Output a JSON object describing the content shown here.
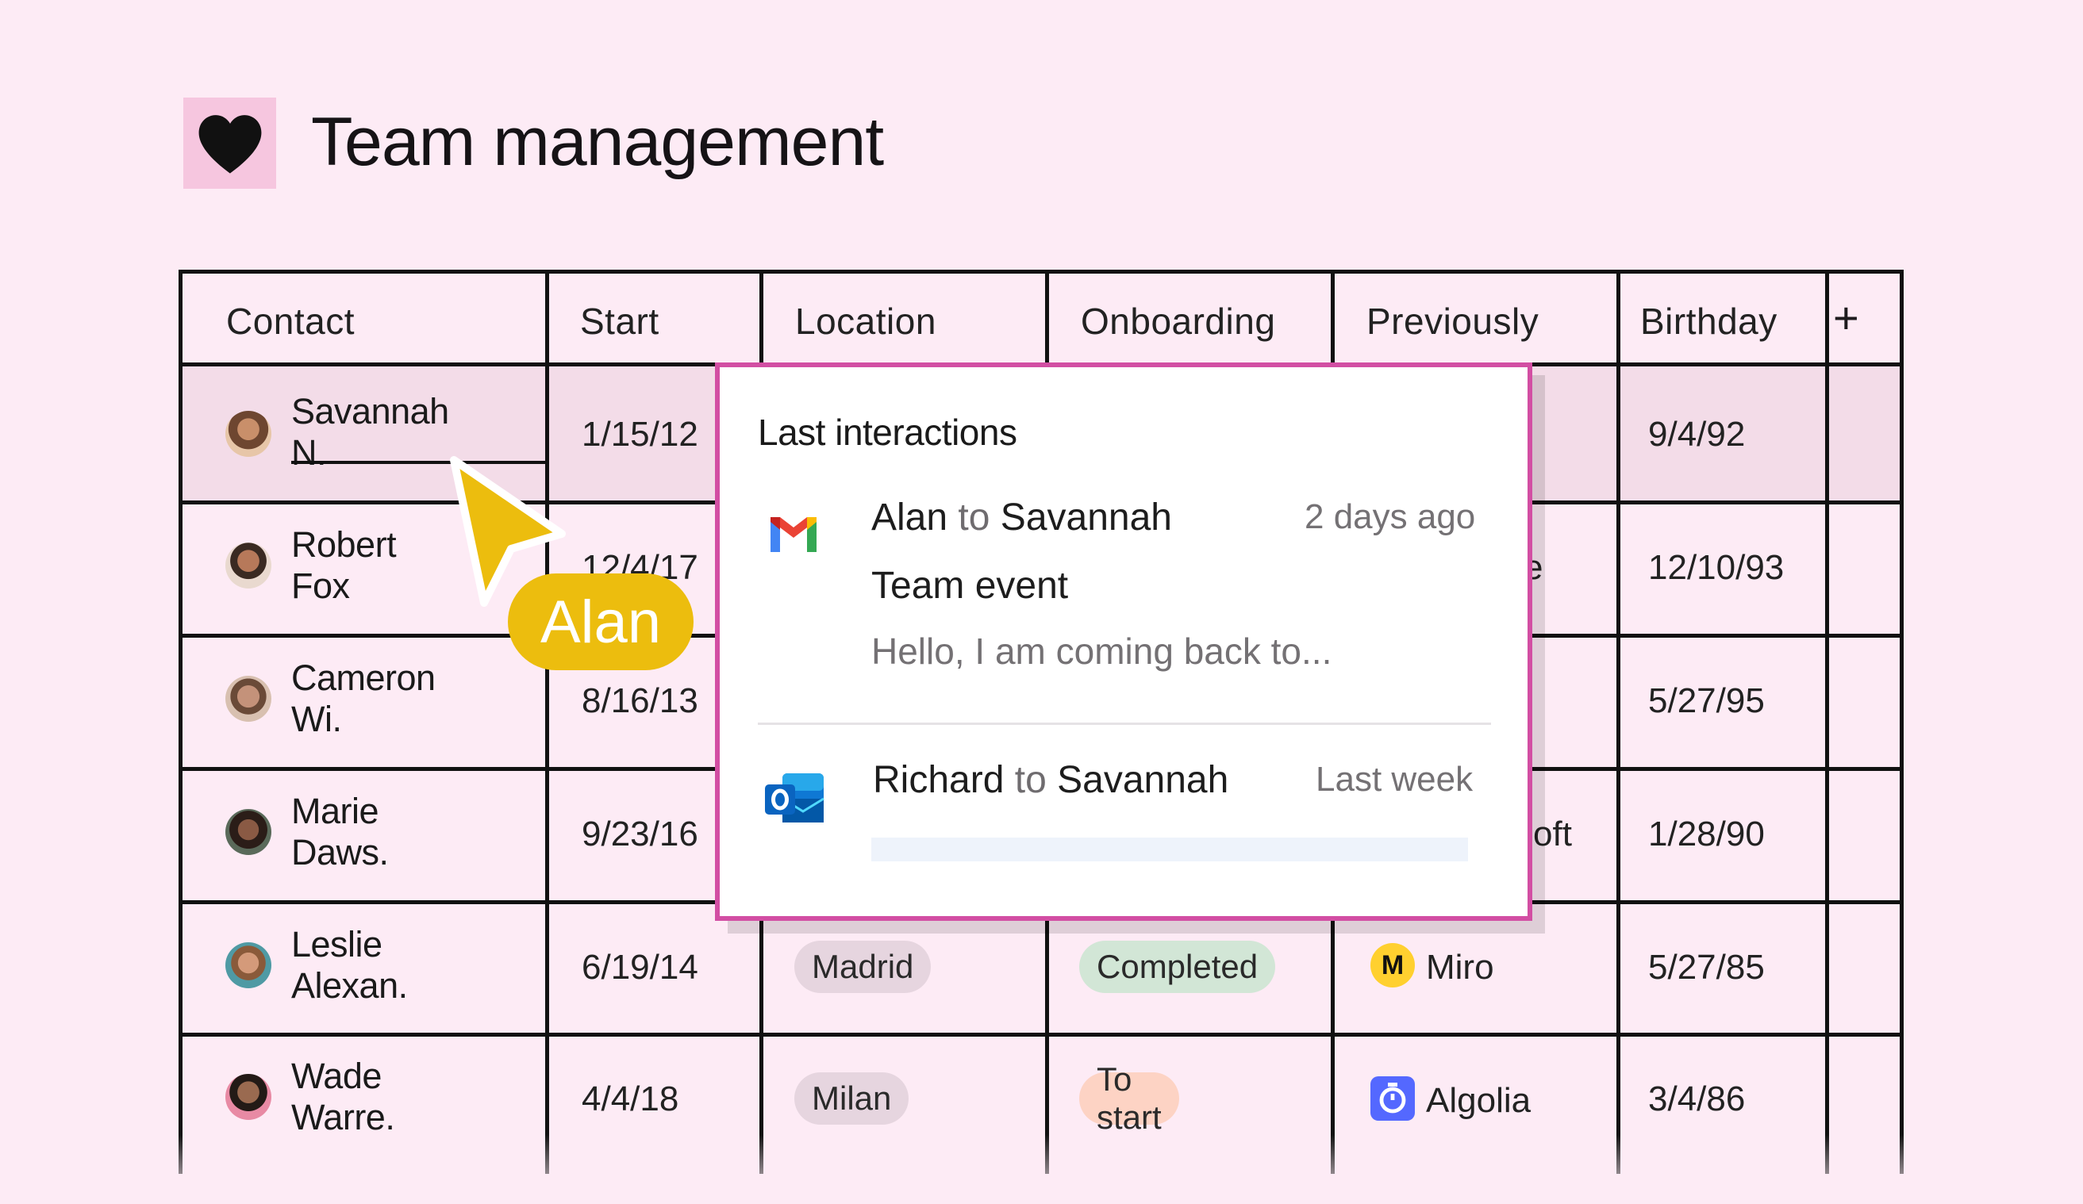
{
  "page": {
    "title": "Team management",
    "icon": "heart-icon"
  },
  "table": {
    "columns": [
      "Contact",
      "Start",
      "Location",
      "Onboarding",
      "Previously",
      "Birthday"
    ],
    "add_column": "+",
    "rows": [
      {
        "contact": "Savannah N.",
        "start": "1/15/12",
        "location": "",
        "onboarding": "",
        "previously": "",
        "birthday": "9/4/92"
      },
      {
        "contact": "Robert Fox",
        "start": "12/4/17",
        "location": "",
        "onboarding": "",
        "previously": "e",
        "birthday": "12/10/93"
      },
      {
        "contact": "Cameron Wi.",
        "start": "8/16/13",
        "location": "",
        "onboarding": "",
        "previously": "",
        "birthday": "5/27/95"
      },
      {
        "contact": "Marie Daws.",
        "start": "9/23/16",
        "location": "",
        "onboarding": "",
        "previously": "oft",
        "birthday": "1/28/90"
      },
      {
        "contact": "Leslie Alexan.",
        "start": "6/19/14",
        "location": "Madrid",
        "onboarding": "Completed",
        "previously": "Miro",
        "birthday": "5/27/85"
      },
      {
        "contact": "Wade Warre.",
        "start": "4/4/18",
        "location": "Milan",
        "onboarding": "To start",
        "previously": "Algolia",
        "birthday": "3/4/86"
      }
    ]
  },
  "popup": {
    "title": "Last interactions",
    "items": [
      {
        "icon": "gmail-icon",
        "from": "Alan",
        "connector": "to",
        "to": "Savannah",
        "time": "2 days ago",
        "subject": "Team event",
        "preview": "Hello, I am coming back to..."
      },
      {
        "icon": "outlook-icon",
        "from": "Richard",
        "connector": "to",
        "to": "Savannah",
        "time": "Last week"
      }
    ]
  },
  "cursor": {
    "label": "Alan",
    "color": "#ecbd0e"
  },
  "colors": {
    "background": "#fdebf5",
    "popup_border": "#d24ea3",
    "pill_location": "#e6d5df",
    "pill_completed": "#d2e6d6",
    "pill_to_start": "#fdd3c4"
  }
}
